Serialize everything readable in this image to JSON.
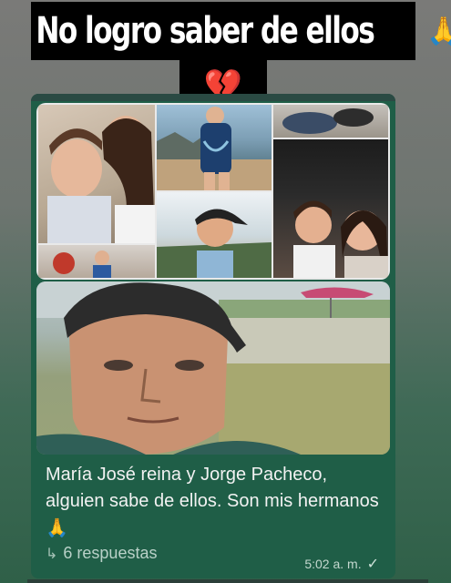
{
  "caption": {
    "line1": "No logro saber de ellos",
    "line1_emoji": "🙏",
    "line2_emoji": "💔"
  },
  "message": {
    "text": "María José reina y Jorge Pacheco, alguien sabe de ellos. Son mis hermanos",
    "text_emoji": "🙏",
    "replies_label": "6 respuestas",
    "time": "5:02 a. m.",
    "status_icon": "double-check-icon"
  },
  "colors": {
    "bubble": "#1f5e47",
    "caption_bg": "#000000",
    "caption_text": "#ffffff"
  }
}
